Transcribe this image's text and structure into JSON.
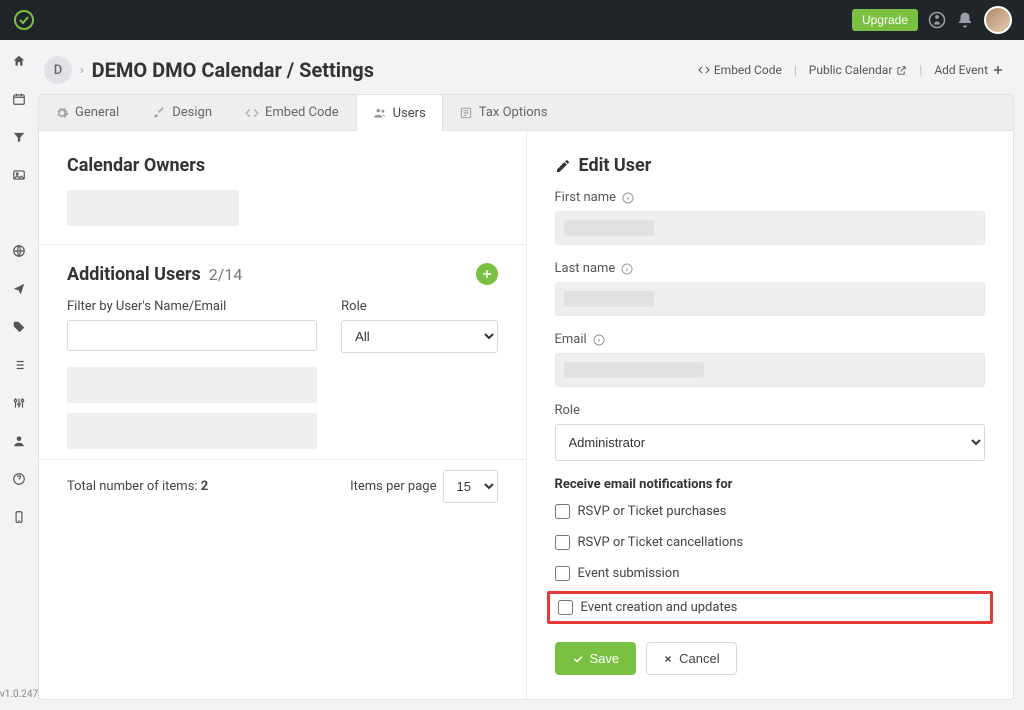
{
  "topbar": {
    "upgrade": "Upgrade"
  },
  "sidebar": {
    "version": "v1.0.247",
    "org_initial": "D"
  },
  "header": {
    "title": "DEMO DMO Calendar / Settings",
    "actions": {
      "embed": "Embed Code",
      "public": "Public Calendar",
      "add_event": "Add Event"
    }
  },
  "tabs": [
    {
      "label": "General",
      "icon": "gear-icon"
    },
    {
      "label": "Design",
      "icon": "brush-icon"
    },
    {
      "label": "Embed Code",
      "icon": "code-icon"
    },
    {
      "label": "Users",
      "icon": "users-icon",
      "active": true
    },
    {
      "label": "Tax Options",
      "icon": "tax-icon"
    }
  ],
  "owners": {
    "title": "Calendar Owners"
  },
  "additional": {
    "title": "Additional Users",
    "count": "2/14",
    "filter_label": "Filter by User's Name/Email",
    "role_label": "Role",
    "role_value": "All",
    "total_label": "Total number of items: ",
    "total_value": "2",
    "items_per_page_label": "Items per page",
    "items_per_page_value": "15"
  },
  "edit_user": {
    "title": "Edit User",
    "first_name_label": "First name",
    "last_name_label": "Last name",
    "email_label": "Email",
    "role_label": "Role",
    "role_value": "Administrator",
    "notif_header": "Receive email notifications for",
    "notif_options": [
      "RSVP or Ticket purchases",
      "RSVP or Ticket cancellations",
      "Event submission",
      "Event creation and updates"
    ],
    "save": "Save",
    "cancel": "Cancel"
  }
}
